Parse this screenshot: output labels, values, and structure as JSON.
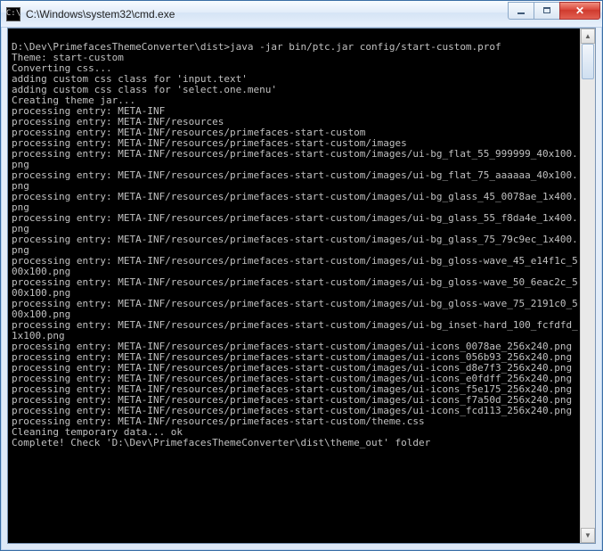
{
  "window": {
    "title": "C:\\Windows\\system32\\cmd.exe",
    "icon_glyph": "C:\\"
  },
  "console": {
    "lines": [
      "",
      "D:\\Dev\\PrimefacesThemeConverter\\dist>java -jar bin/ptc.jar config/start-custom.prof",
      "Theme: start-custom",
      "Converting css...",
      "adding custom css class for 'input.text'",
      "adding custom css class for 'select.one.menu'",
      "Creating theme jar...",
      "processing entry: META-INF",
      "processing entry: META-INF/resources",
      "processing entry: META-INF/resources/primefaces-start-custom",
      "processing entry: META-INF/resources/primefaces-start-custom/images",
      "processing entry: META-INF/resources/primefaces-start-custom/images/ui-bg_flat_55_999999_40x100.png",
      "processing entry: META-INF/resources/primefaces-start-custom/images/ui-bg_flat_75_aaaaaa_40x100.png",
      "processing entry: META-INF/resources/primefaces-start-custom/images/ui-bg_glass_45_0078ae_1x400.png",
      "processing entry: META-INF/resources/primefaces-start-custom/images/ui-bg_glass_55_f8da4e_1x400.png",
      "processing entry: META-INF/resources/primefaces-start-custom/images/ui-bg_glass_75_79c9ec_1x400.png",
      "processing entry: META-INF/resources/primefaces-start-custom/images/ui-bg_gloss-wave_45_e14f1c_500x100.png",
      "processing entry: META-INF/resources/primefaces-start-custom/images/ui-bg_gloss-wave_50_6eac2c_500x100.png",
      "processing entry: META-INF/resources/primefaces-start-custom/images/ui-bg_gloss-wave_75_2191c0_500x100.png",
      "processing entry: META-INF/resources/primefaces-start-custom/images/ui-bg_inset-hard_100_fcfdfd_1x100.png",
      "processing entry: META-INF/resources/primefaces-start-custom/images/ui-icons_0078ae_256x240.png",
      "processing entry: META-INF/resources/primefaces-start-custom/images/ui-icons_056b93_256x240.png",
      "processing entry: META-INF/resources/primefaces-start-custom/images/ui-icons_d8e7f3_256x240.png",
      "processing entry: META-INF/resources/primefaces-start-custom/images/ui-icons_e0fdff_256x240.png",
      "processing entry: META-INF/resources/primefaces-start-custom/images/ui-icons_f5e175_256x240.png",
      "processing entry: META-INF/resources/primefaces-start-custom/images/ui-icons_f7a50d_256x240.png",
      "processing entry: META-INF/resources/primefaces-start-custom/images/ui-icons_fcd113_256x240.png",
      "processing entry: META-INF/resources/primefaces-start-custom/theme.css",
      "Cleaning temporary data... ok",
      "Complete! Check 'D:\\Dev\\PrimefacesThemeConverter\\dist\\theme_out' folder",
      ""
    ]
  }
}
